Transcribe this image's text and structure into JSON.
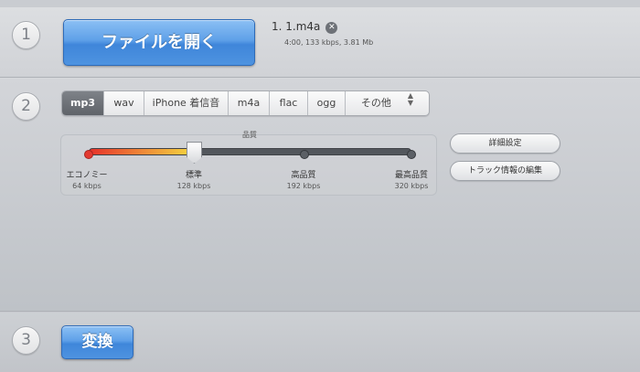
{
  "steps": {
    "one": "1",
    "two": "2",
    "three": "3"
  },
  "open_button": {
    "label": "ファイルを開く"
  },
  "file": {
    "name": "1. 1.m4a",
    "meta": "4:00, 133 kbps, 3.81 Mb",
    "remove_symbol": "✕"
  },
  "formats": {
    "tabs": [
      "mp3",
      "wav",
      "iPhone 着信音",
      "m4a",
      "flac",
      "ogg",
      "その他"
    ],
    "selected": "mp3",
    "more_arrows_up": "▲",
    "more_arrows_down": "▼"
  },
  "quality": {
    "title": "品質",
    "selected_level": 1,
    "levels": [
      {
        "label": "エコノミー",
        "rate": "64 kbps"
      },
      {
        "label": "標準",
        "rate": "128 kbps"
      },
      {
        "label": "高品質",
        "rate": "192 kbps"
      },
      {
        "label": "最高品質",
        "rate": "320 kbps"
      }
    ]
  },
  "buttons": {
    "advanced": "詳細設定",
    "edit_tags": "トラック情報の編集",
    "convert": "変換"
  },
  "colors": {
    "accent_blue": "#4e93e0",
    "slider_red": "#e33a31",
    "slider_yellow": "#f5dc40"
  }
}
